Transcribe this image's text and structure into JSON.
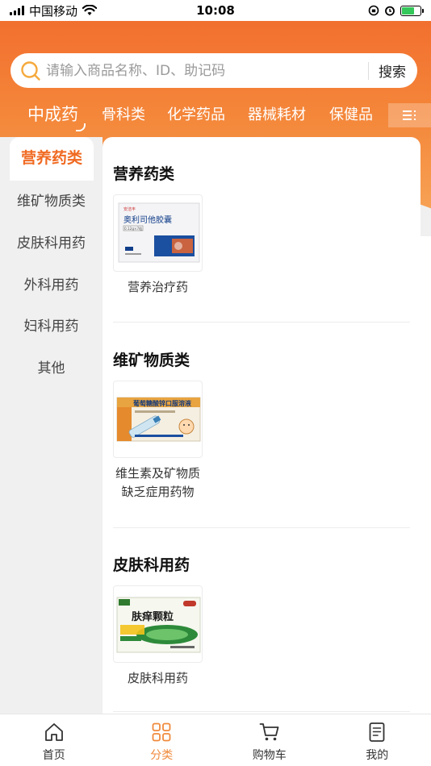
{
  "status_bar": {
    "carrier": "中国移动",
    "time": "10:08"
  },
  "search": {
    "placeholder": "请输入商品名称、ID、助记码",
    "button_label": "搜索"
  },
  "category_tabs": [
    {
      "label": "中成药",
      "active": true
    },
    {
      "label": "骨科类",
      "active": false
    },
    {
      "label": "化学药品",
      "active": false
    },
    {
      "label": "器械耗材",
      "active": false
    },
    {
      "label": "保健品",
      "active": false
    }
  ],
  "sidebar": {
    "items": [
      {
        "label": "营养药类",
        "active": true
      },
      {
        "label": "维矿物质类",
        "active": false
      },
      {
        "label": "皮肤科用药",
        "active": false
      },
      {
        "label": "外科用药",
        "active": false
      },
      {
        "label": "妇科用药",
        "active": false
      },
      {
        "label": "其他",
        "active": false
      }
    ]
  },
  "sections": [
    {
      "title": "营养药类",
      "products": [
        {
          "label": "营养治疗药",
          "package_brand": "安洁丰",
          "package_name": "奥利司他胶囊",
          "package_spec": "0.12g×7粒"
        }
      ]
    },
    {
      "title": "维矿物质类",
      "products": [
        {
          "label_line1": "维生素及矿物质",
          "label_line2": "缺乏症用药物",
          "package_name": "葡萄糖酸锌口服溶液"
        }
      ]
    },
    {
      "title": "皮肤科用药",
      "products": [
        {
          "label": "皮肤科用药",
          "package_name": "肤痒颗粒"
        }
      ]
    }
  ],
  "bottom_nav": [
    {
      "label": "首页",
      "icon": "home-icon",
      "active": false
    },
    {
      "label": "分类",
      "icon": "grid-icon",
      "active": true
    },
    {
      "label": "购物车",
      "icon": "cart-icon",
      "active": false
    },
    {
      "label": "我的",
      "icon": "document-icon",
      "active": false
    }
  ],
  "colors": {
    "accent": "#f06a22",
    "header_orange": "#f4873a",
    "nav_active": "#f08a3c"
  }
}
